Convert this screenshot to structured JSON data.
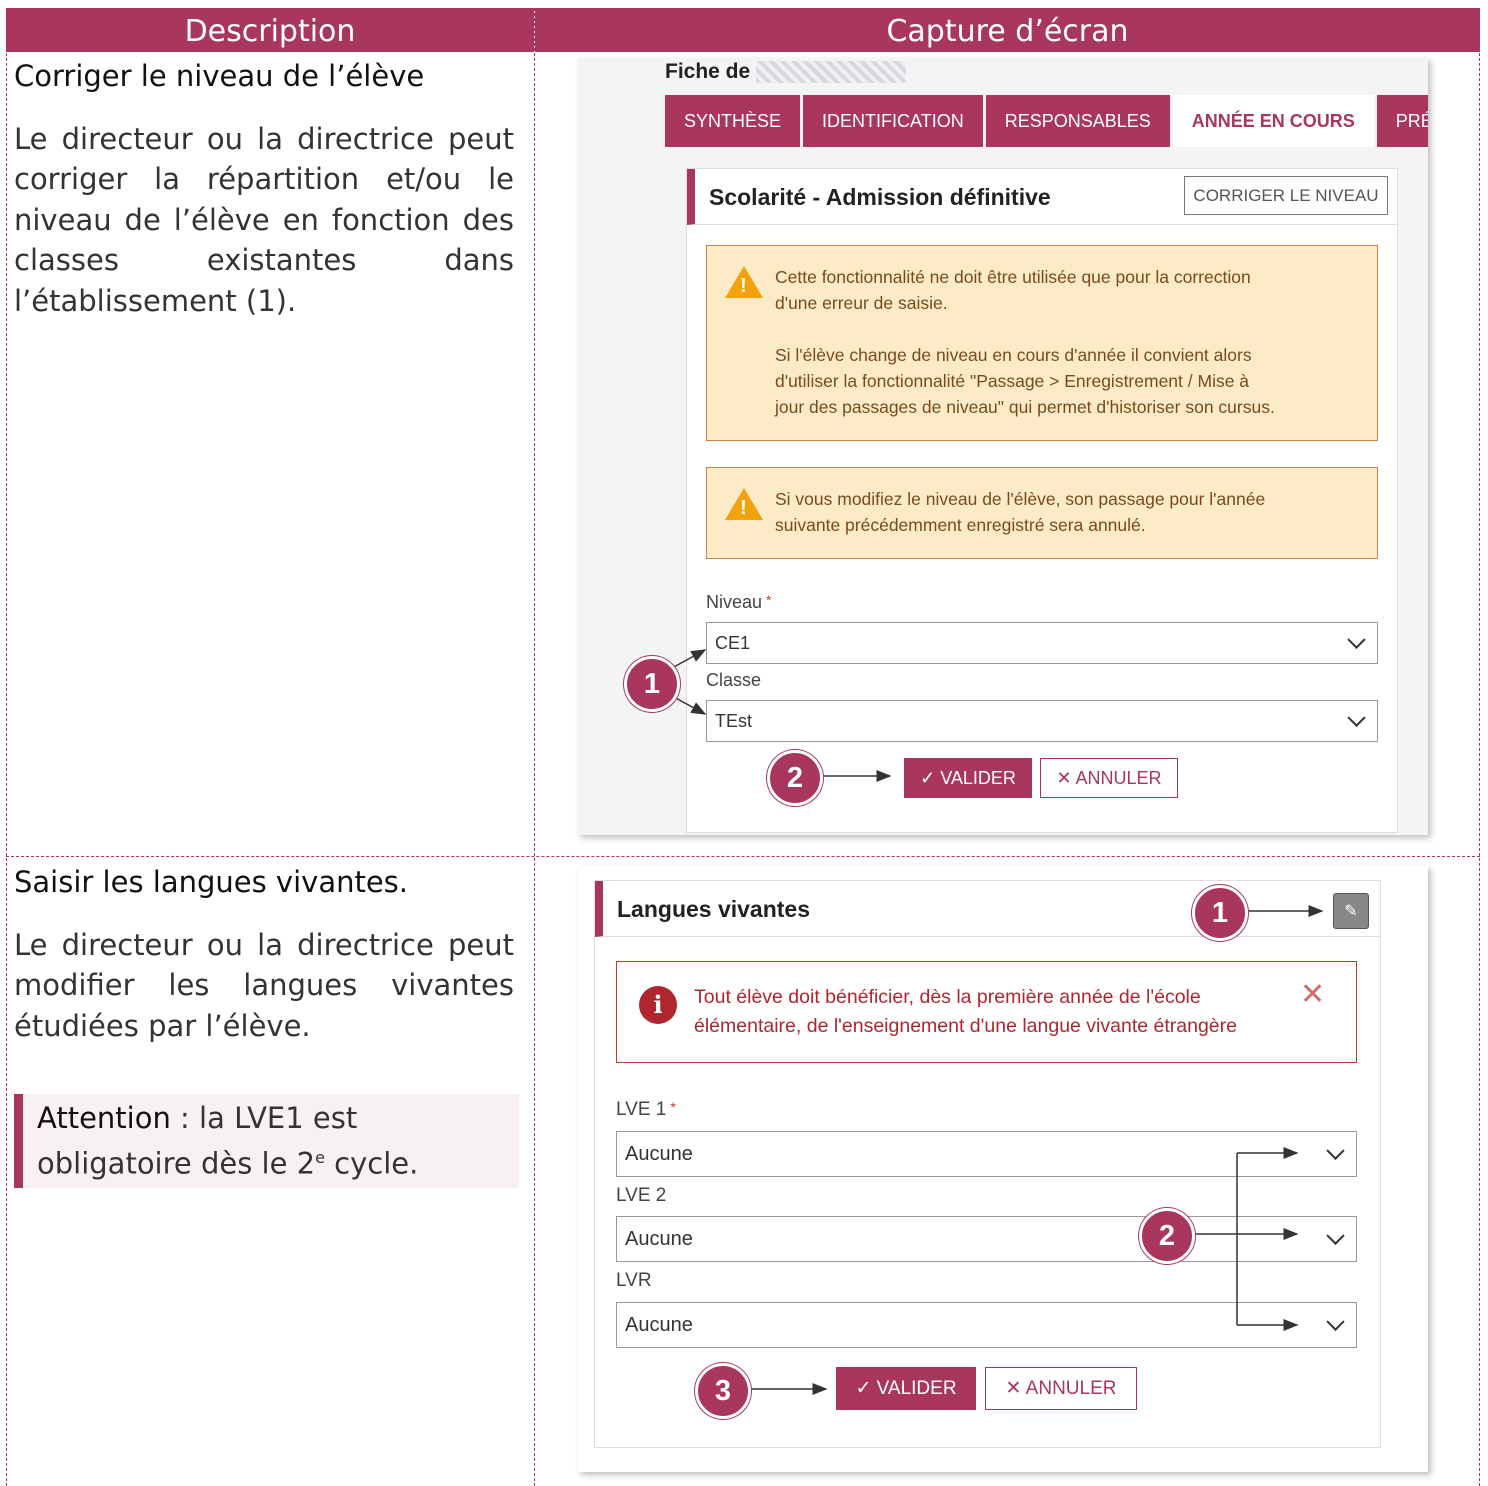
{
  "header": {
    "description": "Description",
    "capture": "Capture d’écran"
  },
  "row1": {
    "title": "Corriger le niveau de l’élève",
    "paragraph": "Le directeur ou la directrice peut corriger la répartition et/ou le niveau de l’élève en fonction des classes existantes dans l’établissement (1).",
    "screen": {
      "fiche_label": "Fiche de",
      "tabs": [
        "SYNTHÈSE",
        "IDENTIFICATION",
        "RESPONSABLES",
        "ANNÉE EN COURS",
        "PRÉPA"
      ],
      "active_tab": 3,
      "panel_title": "Scolarité - Admission définitive",
      "corriger_button": "CORRIGER LE NIVEAU",
      "warning1_line1": "Cette fonctionnalité ne doit être utilisée que pour la correction",
      "warning1_line2": "d'une erreur de saisie.",
      "warning1_line3": "Si l'élève change de niveau en cours d'année il convient alors",
      "warning1_line4": "d'utiliser la fonctionnalité \"Passage > Enregistrement / Mise à",
      "warning1_line5": "jour des passages de niveau\" qui permet d'historiser son cursus.",
      "warning2_line1": "Si vous modifiez le niveau de l'élève, son passage pour l'année",
      "warning2_line2": "suivante précédemment enregistré sera annulé.",
      "niveau_label": "Niveau",
      "required_mark": "*",
      "niveau_value": "CE1",
      "classe_label": "Classe",
      "classe_value": "TEst",
      "valider": "VALIDER",
      "annuler": "ANNULER",
      "badge1": "1",
      "badge2": "2"
    }
  },
  "row2": {
    "title": "Saisir les langues vivantes.",
    "paragraph": "Le directeur ou la directrice peut modifier les langues vivantes étudiées par l’élève.",
    "attention_label": "Attention",
    "attention_text_a": " : la LVE1 est obligatoire dès le 2",
    "attention_sup": "e",
    "attention_text_b": " cycle.",
    "screen": {
      "panel_title": "Langues vivantes",
      "info_line1": "Tout élève doit bénéficier, dès la première année de l'école",
      "info_line2": "élémentaire, de l'enseignement d'une langue vivante étrangère",
      "lve1_label": "LVE 1",
      "required_mark": "*",
      "lve1_value": "Aucune",
      "lve2_label": "LVE 2",
      "lve2_value": "Aucune",
      "lvr_label": "LVR",
      "lvr_value": "Aucune",
      "valider": "VALIDER",
      "annuler": "ANNULER",
      "badge1": "1",
      "badge2": "2",
      "badge3": "3"
    }
  },
  "colors": {
    "brand": "#a8365f",
    "warning_bg": "#fdebc8",
    "error": "#b0262f"
  }
}
